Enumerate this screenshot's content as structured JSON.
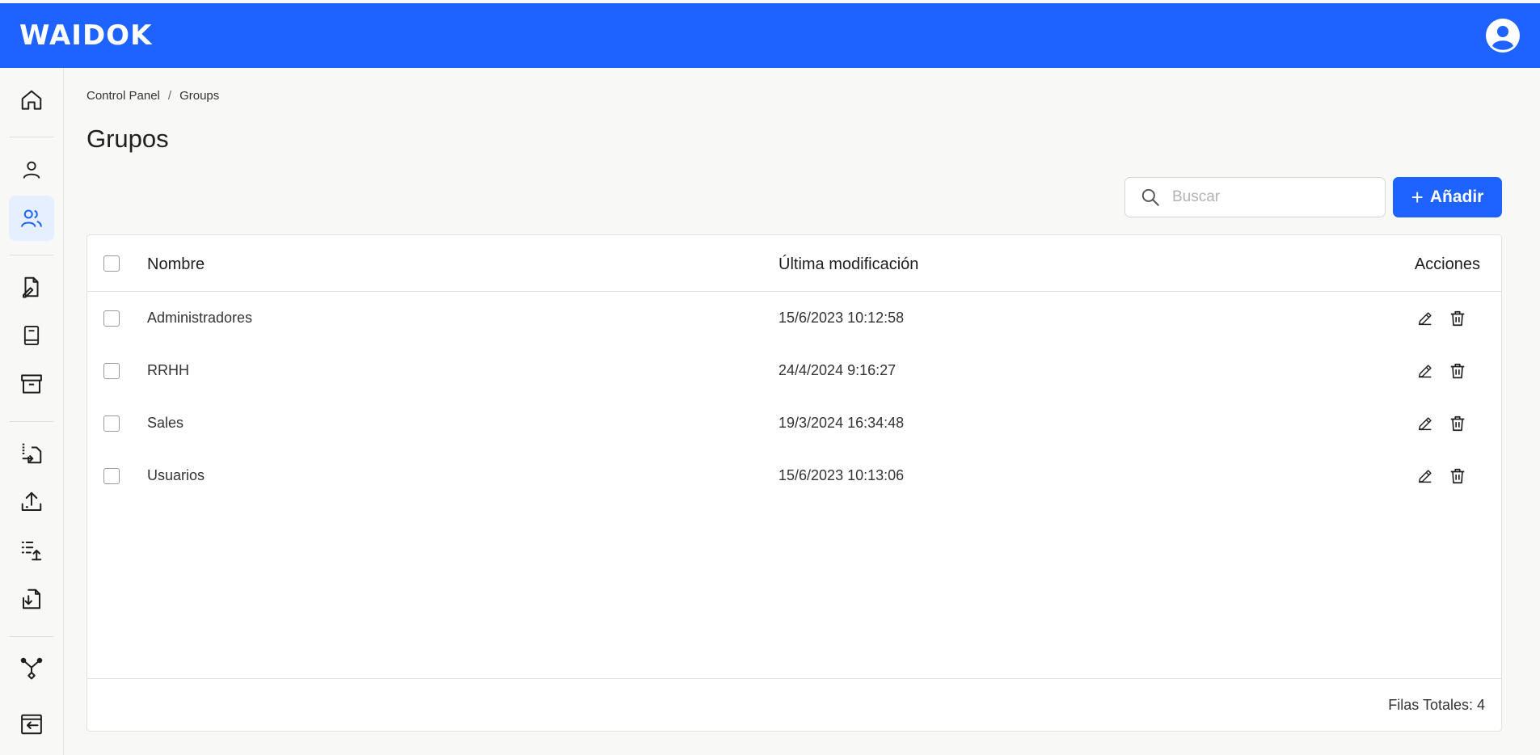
{
  "header": {
    "logo_text": "WAIDOK",
    "avatar_icon": "user-circle-icon",
    "brand_color": "#1e62ff"
  },
  "sidebar": {
    "items": [
      {
        "icon": "home-icon",
        "active": false
      },
      {
        "icon": "user-icon",
        "active": false
      },
      {
        "icon": "users-icon",
        "active": true
      },
      {
        "icon": "document-edit-icon",
        "active": false
      },
      {
        "icon": "book-icon",
        "active": false
      },
      {
        "icon": "archive-icon",
        "active": false
      },
      {
        "icon": "file-transfer-icon",
        "active": false
      },
      {
        "icon": "upload-icon",
        "active": false
      },
      {
        "icon": "list-upload-icon",
        "active": false
      },
      {
        "icon": "file-download-icon",
        "active": false
      },
      {
        "icon": "workflow-icon",
        "active": false
      },
      {
        "icon": "logout-icon",
        "active": false
      }
    ]
  },
  "breadcrumb": {
    "items": [
      "Control Panel",
      "Groups"
    ],
    "separator": "/"
  },
  "page": {
    "title": "Grupos"
  },
  "search": {
    "value": "",
    "placeholder": "Buscar"
  },
  "toolbar": {
    "add_label": "Añadir"
  },
  "table": {
    "columns": {
      "name": "Nombre",
      "modified": "Última modificación",
      "actions": "Acciones"
    },
    "rows": [
      {
        "name": "Administradores",
        "modified": "15/6/2023 10:12:58"
      },
      {
        "name": "RRHH",
        "modified": "24/4/2024 9:16:27"
      },
      {
        "name": "Sales",
        "modified": "19/3/2024 16:34:48"
      },
      {
        "name": "Usuarios",
        "modified": "15/6/2023 10:13:06"
      }
    ],
    "footer": {
      "total_label": "Filas Totales: 4"
    }
  }
}
